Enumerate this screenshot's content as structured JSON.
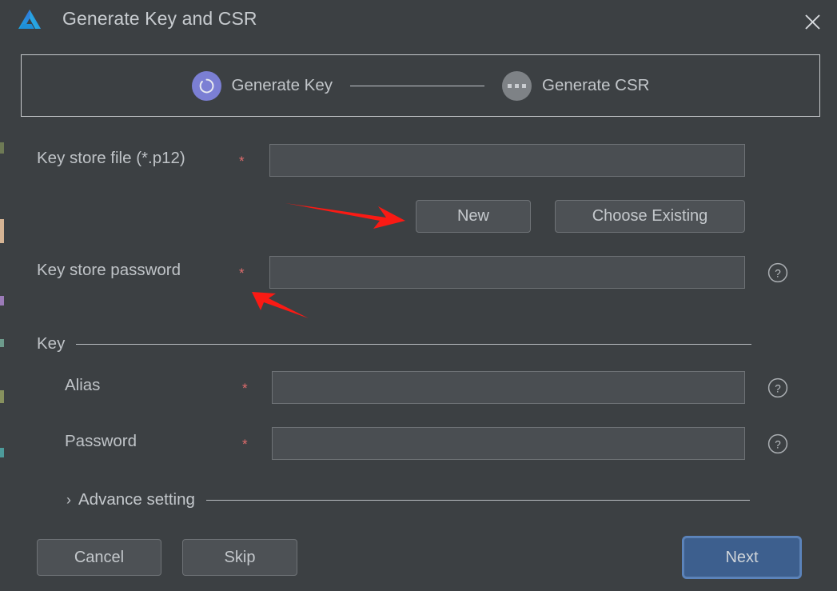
{
  "window": {
    "title": "Generate Key and CSR",
    "logo_icon": "deveco-studio-logo",
    "close_icon": "close-icon"
  },
  "stepper": {
    "steps": [
      {
        "label": "Generate Key",
        "state": "active",
        "icon": "spinner-circle-icon"
      },
      {
        "label": "Generate CSR",
        "state": "pending",
        "icon": "ellipsis-icon"
      }
    ]
  },
  "form": {
    "key_store_file": {
      "label": "Key store file (*.p12)",
      "required_marker": "*",
      "value": "",
      "placeholder": ""
    },
    "file_buttons": {
      "new": "New",
      "choose_existing": "Choose Existing"
    },
    "key_store_password": {
      "label": "Key store password",
      "required_marker": "*",
      "value": "",
      "placeholder": "",
      "help_icon": "question-mark-icon"
    },
    "key_section": {
      "title": "Key",
      "alias": {
        "label": "Alias",
        "required_marker": "*",
        "value": "",
        "placeholder": "",
        "help_icon": "question-mark-icon"
      },
      "password": {
        "label": "Password",
        "required_marker": "*",
        "value": "",
        "placeholder": "",
        "help_icon": "question-mark-icon"
      }
    },
    "advance_setting": {
      "label": "Advance setting",
      "expanded": false,
      "chevron_icon": "chevron-right-icon"
    }
  },
  "footer": {
    "cancel": "Cancel",
    "skip": "Skip",
    "next": "Next"
  },
  "annotations": {
    "arrow_to_new_button": "red-arrow-right",
    "arrow_to_password_field": "red-arrow-up-left",
    "color": "#fa1a14"
  },
  "colors": {
    "dialog_background": "#3c4043",
    "field_background": "#4a4e52",
    "field_border": "#6e7276",
    "text": "#bfc3c7",
    "required_asterisk": "#e06c6c",
    "step_active": "#7b7fd4",
    "step_pending": "#7e8286",
    "primary_button": "#3d5f8e",
    "primary_focus_ring": "#5b84bd",
    "annotation_red": "#fa1a14"
  }
}
